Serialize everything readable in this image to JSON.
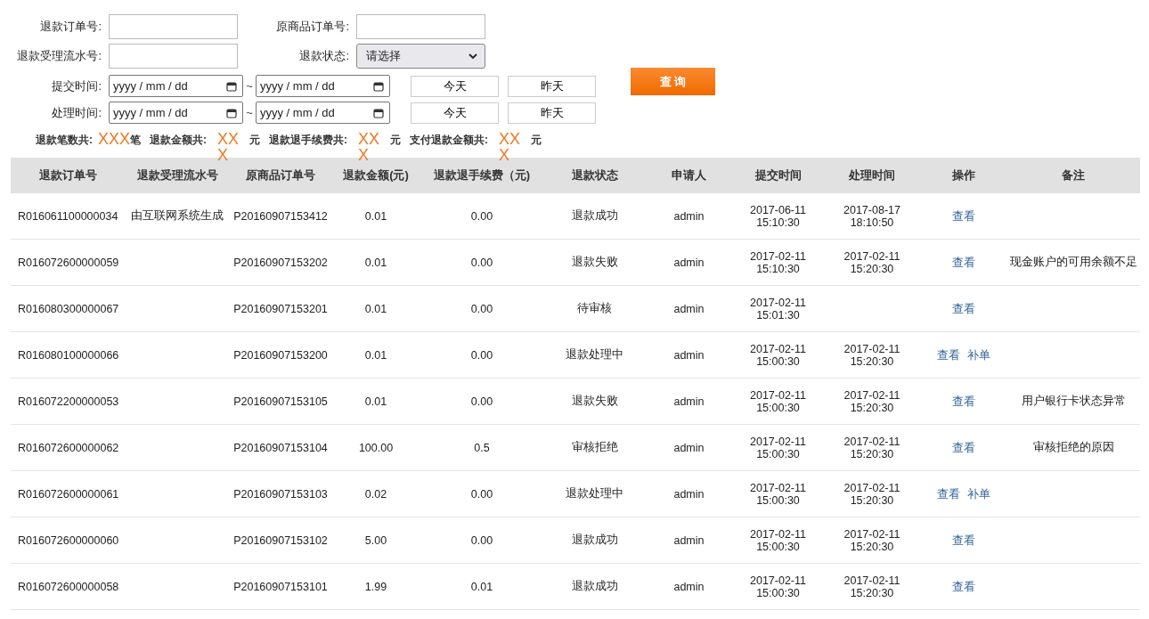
{
  "filters": {
    "refund_order_no": {
      "label": "退款订单号:"
    },
    "original_order_no": {
      "label": "原商品订单号:"
    },
    "serial_no": {
      "label": "退款受理流水号:"
    },
    "refund_status": {
      "label": "退款状态:",
      "value": "请选择"
    },
    "date_ranges": [
      {
        "label": "提交时间:",
        "from_placeholder": "yyyy / mm / dd",
        "separator": "~",
        "to_placeholder": "yyyy / mm / dd",
        "today": "今天",
        "yesterday": "昨天"
      },
      {
        "label": "处理时间:",
        "from_placeholder": "yyyy / mm / dd",
        "separator": "~",
        "to_placeholder": "yyyy / mm / dd",
        "today": "今天",
        "yesterday": "昨天"
      }
    ],
    "query_button": "查 询"
  },
  "summary": [
    {
      "label": "退款笔数共:",
      "value": "XXX",
      "unit": "笔"
    },
    {
      "label": "退款金额共:",
      "value": "XXX",
      "unit": "元"
    },
    {
      "label": "退款退手续费共:",
      "value": "XXX",
      "unit": "元"
    },
    {
      "label": "支付退款金额共:",
      "value": "XXX",
      "unit": "元"
    }
  ],
  "table": {
    "columns": [
      "退款订单号",
      "退款受理流水号",
      "原商品订单号",
      "退款金额(元)",
      "退款退手续费（元)",
      "退款状态",
      "申请人",
      "提交时间",
      "处理时间",
      "操作",
      "备注"
    ],
    "rows": [
      {
        "refund_no": "R016061100000034",
        "serial_no": "由互联网系统生成",
        "order_no": "P20160907153412",
        "amount": "0.01",
        "fee": "0.00",
        "status": "退款成功",
        "applicant": "admin",
        "submitted": "2017-06-11 15:10:30",
        "processed": "2017-08-17 18:10:50",
        "actions": [
          "查看"
        ]
      },
      {
        "refund_no": "R016072600000059",
        "order_no": "P20160907153202",
        "amount": "0.01",
        "fee": "0.00",
        "status": "退款失败",
        "applicant": "admin",
        "submitted": "2017-02-11 15:10:30",
        "processed": "2017-02-11 15:20:30",
        "actions": [
          "查看"
        ],
        "note": "现金账户的可用余额不足"
      },
      {
        "refund_no": "R016080300000067",
        "order_no": "P20160907153201",
        "amount": "0.01",
        "fee": "0.00",
        "status": "待审核",
        "applicant": "admin",
        "submitted": "2017-02-11 15:01:30",
        "actions": [
          "查看"
        ]
      },
      {
        "refund_no": "R016080100000066",
        "order_no": "P20160907153200",
        "amount": "0.01",
        "fee": "0.00",
        "status": "退款处理中",
        "applicant": "admin",
        "submitted": "2017-02-11 15:00:30",
        "processed": "2017-02-11 15:20:30",
        "actions": [
          "查看",
          "补单"
        ]
      },
      {
        "refund_no": "R016072200000053",
        "order_no": "P20160907153105",
        "amount": "0.01",
        "fee": "0.00",
        "status": "退款失败",
        "applicant": "admin",
        "submitted": "2017-02-11 15:00:30",
        "processed": "2017-02-11 15:20:30",
        "actions": [
          "查看"
        ],
        "note": "用户银行卡状态异常"
      },
      {
        "refund_no": "R016072600000062",
        "order_no": "P20160907153104",
        "amount": "100.00",
        "fee": "0.5",
        "status": "审核拒绝",
        "applicant": "admin",
        "submitted": "2017-02-11 15:00:30",
        "processed": "2017-02-11 15:20:30",
        "actions": [
          "查看"
        ],
        "note": "审核拒绝的原因"
      },
      {
        "refund_no": "R016072600000061",
        "order_no": "P20160907153103",
        "amount": "0.02",
        "fee": "0.00",
        "status": "退款处理中",
        "applicant": "admin",
        "submitted": "2017-02-11 15:00:30",
        "processed": "2017-02-11 15:20:30",
        "actions": [
          "查看",
          "补单"
        ]
      },
      {
        "refund_no": "R016072600000060",
        "order_no": "P20160907153102",
        "amount": "5.00",
        "fee": "0.00",
        "status": "退款成功",
        "applicant": "admin",
        "submitted": "2017-02-11 15:00:30",
        "processed": "2017-02-11 15:20:30",
        "actions": [
          "查看"
        ]
      },
      {
        "refund_no": "R016072600000058",
        "order_no": "P20160907153101",
        "amount": "1.99",
        "fee": "0.01",
        "status": "退款成功",
        "applicant": "admin",
        "submitted": "2017-02-11 15:00:30",
        "processed": "2017-02-11 15:20:30",
        "actions": [
          "查看"
        ]
      }
    ]
  }
}
